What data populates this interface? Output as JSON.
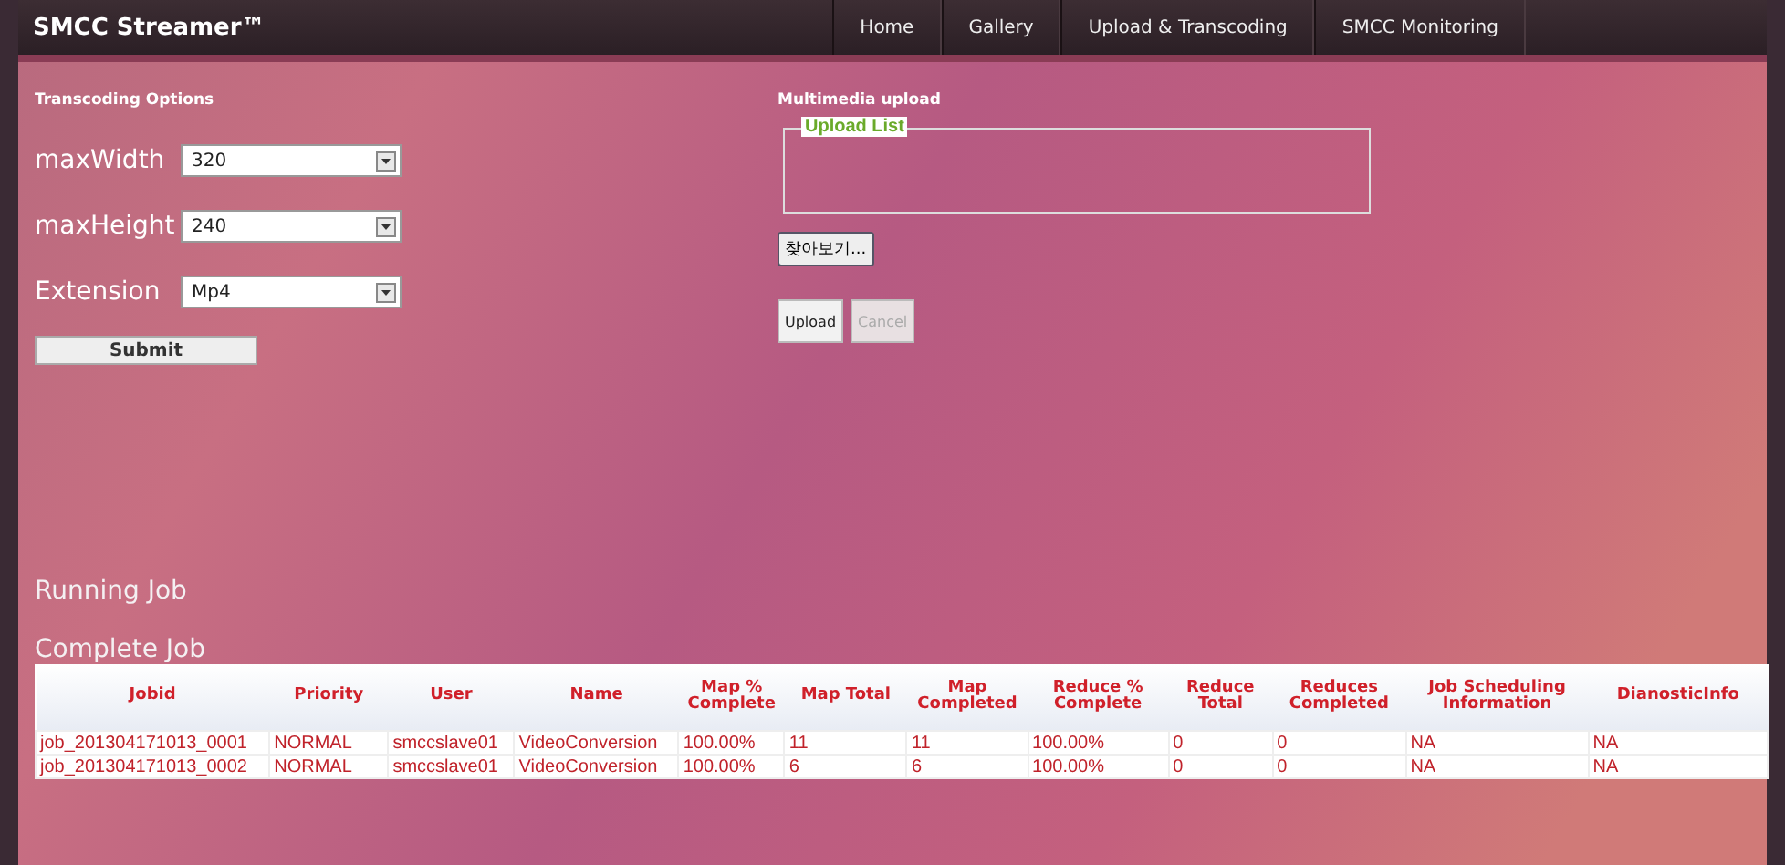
{
  "app_title": "SMCC Streamer™",
  "nav": [
    {
      "label": "Home"
    },
    {
      "label": "Gallery"
    },
    {
      "label": "Upload & Transcoding"
    },
    {
      "label": "SMCC Monitoring"
    }
  ],
  "transcoding": {
    "heading": "Transcoding Options",
    "fields": [
      {
        "label": "maxWidth",
        "value": "320"
      },
      {
        "label": "maxHeight",
        "value": "240"
      },
      {
        "label": "Extension",
        "value": "Mp4"
      }
    ],
    "submit": "Submit"
  },
  "upload": {
    "heading": "Multimedia upload",
    "legend": "Upload List",
    "browse": "찾아보기...",
    "buttons": [
      {
        "label": "Upload",
        "disabled": false
      },
      {
        "label": "Cancel",
        "disabled": true
      }
    ]
  },
  "running_heading": "Running Job",
  "complete_heading": "Complete Job",
  "table": {
    "columns": [
      "Jobid",
      "Priority",
      "User",
      "Name",
      "Map % Complete",
      "Map Total",
      "Map Completed",
      "Reduce % Complete",
      "Reduce Total",
      "Reduces Completed",
      "Job Scheduling Information",
      "DianosticInfo"
    ],
    "rows": [
      [
        "job_201304171013_0001",
        "NORMAL",
        "smccslave01",
        "VideoConversion",
        "100.00%",
        "11",
        "11",
        "100.00%",
        "0",
        "0",
        "NA",
        "NA"
      ],
      [
        "job_201304171013_0002",
        "NORMAL",
        "smccslave01",
        "VideoConversion",
        "100.00%",
        "6",
        "6",
        "100.00%",
        "0",
        "0",
        "NA",
        "NA"
      ]
    ]
  }
}
